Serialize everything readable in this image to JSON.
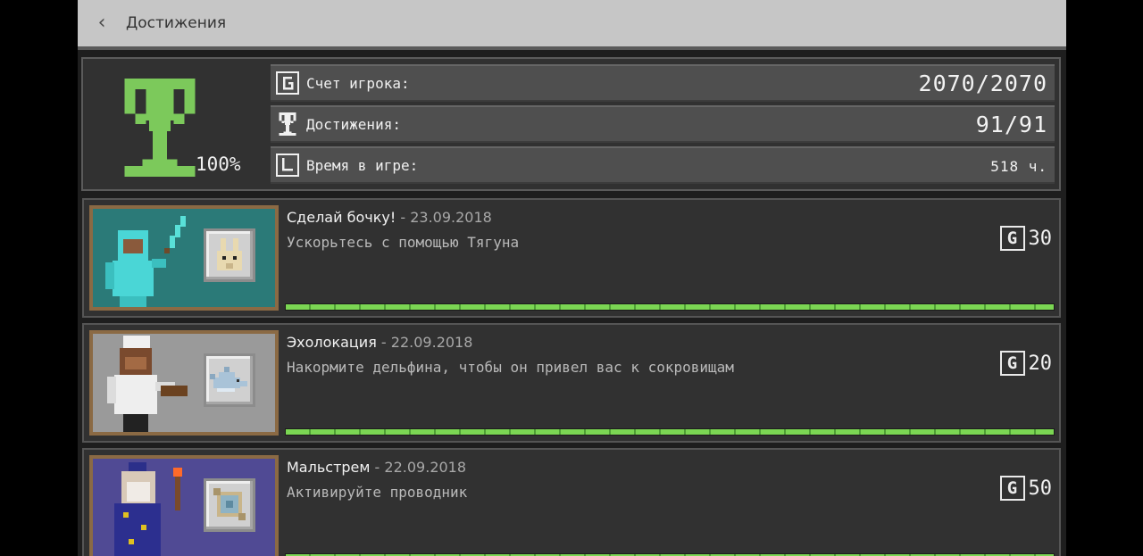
{
  "header": {
    "back_icon": "chevron-left-icon",
    "title": "Достижения"
  },
  "summary": {
    "completion_percent": "100%",
    "rows": [
      {
        "icon": "g-score-icon",
        "label": "Счет игрока:",
        "value": "2070/2070"
      },
      {
        "icon": "trophy-icon",
        "label": "Достижения:",
        "value": "91/91"
      },
      {
        "icon": "clock-icon",
        "label": "Время в игре:",
        "value": "518 ч."
      }
    ]
  },
  "achievements": [
    {
      "name": "Сделай бочку!",
      "separator": "-",
      "date": "23.09.2018",
      "description": "Ускорьтесь с помощью Тягуна",
      "gamerscore_icon": "G",
      "points": "30",
      "progress": 1.0
    },
    {
      "name": "Эхолокация",
      "separator": "-",
      "date": "22.09.2018",
      "description": "Накормите дельфина, чтобы он привел вас к сокровищам",
      "gamerscore_icon": "G",
      "points": "20",
      "progress": 1.0
    },
    {
      "name": "Мальстрем",
      "separator": "-",
      "date": "22.09.2018",
      "description": "Активируйте проводник",
      "gamerscore_icon": "G",
      "points": "50",
      "progress": 1.0
    }
  ],
  "colors": {
    "progress_green": "#7bd653",
    "trophy_green": "#7cc95b",
    "card_frame": "#8b6a44"
  }
}
